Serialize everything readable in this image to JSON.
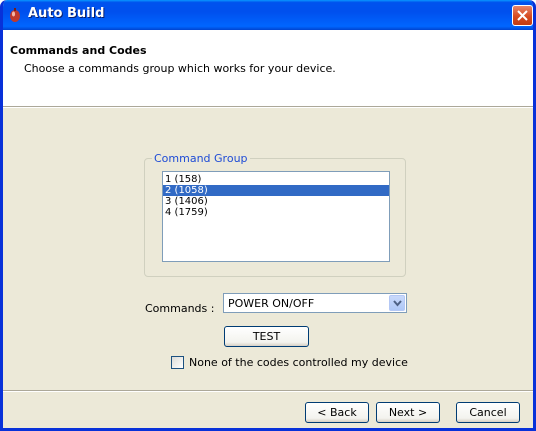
{
  "window": {
    "title": "Auto Build",
    "icon": "app-icon",
    "close_icon": "close-icon"
  },
  "header": {
    "title": "Commands and Codes",
    "subtitle": "Choose a commands group which works for your device."
  },
  "command_group": {
    "legend": "Command Group",
    "items": [
      {
        "label": "1 (158)",
        "selected": false
      },
      {
        "label": "2 (1058)",
        "selected": true
      },
      {
        "label": "3 (1406)",
        "selected": false
      },
      {
        "label": "4 (1759)",
        "selected": false
      }
    ]
  },
  "commands": {
    "label": "Commands :",
    "selected_value": "POWER ON/OFF"
  },
  "test_button": "TEST",
  "none_checkbox": {
    "label": "None of the codes controlled my device",
    "checked": false
  },
  "footer": {
    "back": "< Back",
    "next": "Next >",
    "cancel": "Cancel"
  },
  "colors": {
    "titlebar": "#0053ee",
    "selection": "#316ac5",
    "legend_text": "#1f4cd6",
    "dialog_bg": "#ece9d8"
  }
}
